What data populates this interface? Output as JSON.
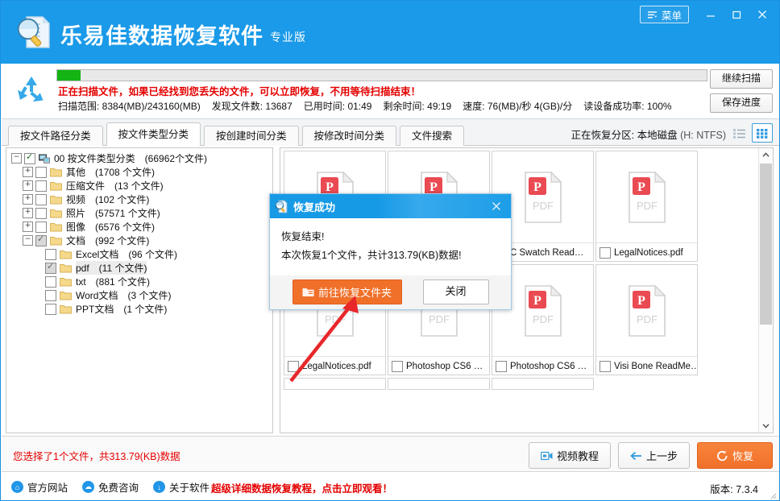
{
  "titlebar": {
    "brand": "乐易佳数据恢复软件",
    "edition": "专业版",
    "logo_icon": "magnifier-document-icon",
    "menu_label": "菜单",
    "menu_icon": "menu-lines-icon",
    "minimize_icon": "minimize-icon",
    "maximize_icon": "maximize-icon",
    "close_icon": "close-icon",
    "bg_color": "#1a9ae8"
  },
  "scan": {
    "recycle_icon": "recycle-arrows-icon",
    "progress_percent": 3.6,
    "progress_color": "#14b414",
    "warning": "正在扫描文件，如果已经找到您丢失的文件，可以立即恢复，不用等待扫描结束！",
    "warning_color": "#e40000",
    "stats": [
      "扫描范围: 8384(MB)/243160(MB)",
      "发现文件数: 13687",
      "已用时间: 01:49",
      "剩余时间: 49:19",
      "速度: 76(MB)/秒 4(GB)/分",
      "读设备成功率: 100%"
    ],
    "continue_label": "继续扫描",
    "save_label": "保存进度"
  },
  "tabs": {
    "items": [
      {
        "label": "按文件路径分类",
        "active": false
      },
      {
        "label": "按文件类型分类",
        "active": true
      },
      {
        "label": "按创建时间分类",
        "active": false
      },
      {
        "label": "按修改时间分类",
        "active": false
      },
      {
        "label": "文件搜索",
        "active": false
      }
    ],
    "partition_prefix": "正在恢复分区: 本地磁盘",
    "partition_detail": "(H: NTFS)",
    "list_view_icon": "list-view-icon",
    "grid_view_icon": "grid-view-icon",
    "active_view": "grid"
  },
  "tree": {
    "nodes": [
      {
        "indent": 0,
        "expander": "minus",
        "checked": true,
        "gray": false,
        "icon": "computer-icon",
        "label": "00 按文件类型分类　(66962个文件)",
        "selected": false
      },
      {
        "indent": 1,
        "expander": "plus",
        "checked": false,
        "gray": false,
        "icon": "folder-icon",
        "label": "其他　(1708 个文件)",
        "selected": false
      },
      {
        "indent": 1,
        "expander": "plus",
        "checked": false,
        "gray": false,
        "icon": "folder-icon",
        "label": "压缩文件　(13 个文件)",
        "selected": false
      },
      {
        "indent": 1,
        "expander": "plus",
        "checked": false,
        "gray": false,
        "icon": "folder-icon",
        "label": "视频　(102 个文件)",
        "selected": false
      },
      {
        "indent": 1,
        "expander": "plus",
        "checked": false,
        "gray": false,
        "icon": "folder-icon",
        "label": "照片　(57571 个文件)",
        "selected": false
      },
      {
        "indent": 1,
        "expander": "plus",
        "checked": false,
        "gray": false,
        "icon": "folder-icon",
        "label": "图像　(6576 个文件)",
        "selected": false
      },
      {
        "indent": 1,
        "expander": "minus",
        "checked": true,
        "gray": true,
        "icon": "folder-icon",
        "label": "文档　(992 个文件)",
        "selected": false
      },
      {
        "indent": 2,
        "expander": "none",
        "checked": false,
        "gray": false,
        "icon": "folder-icon",
        "label": "Excel文档　(96 个文件)",
        "selected": false
      },
      {
        "indent": 2,
        "expander": "none",
        "checked": true,
        "gray": true,
        "icon": "folder-icon",
        "label": "pdf　(11 个文件)",
        "selected": true
      },
      {
        "indent": 2,
        "expander": "none",
        "checked": false,
        "gray": false,
        "icon": "folder-icon",
        "label": "txt　(881 个文件)",
        "selected": false
      },
      {
        "indent": 2,
        "expander": "none",
        "checked": false,
        "gray": false,
        "icon": "folder-icon",
        "label": "Word文档　(3 个文件)",
        "selected": false
      },
      {
        "indent": 2,
        "expander": "none",
        "checked": false,
        "gray": false,
        "icon": "folder-icon",
        "label": "PPT文档　(1 个文件)",
        "selected": false
      }
    ]
  },
  "filegrid": {
    "tiles": [
      {
        "name": "",
        "icon": "pdf-file-icon",
        "checked": false,
        "row": 0,
        "col": 0,
        "partial": false
      },
      {
        "name": "",
        "icon": "pdf-file-icon",
        "checked": false,
        "row": 0,
        "col": 1,
        "partial": false
      },
      {
        "name": "C Swatch Read…",
        "icon": "pdf-file-icon",
        "checked": false,
        "row": 0,
        "col": 2,
        "partial": false
      },
      {
        "name": "LegalNotices.pdf",
        "icon": "pdf-file-icon",
        "checked": false,
        "row": 0,
        "col": 3,
        "partial": false
      },
      {
        "name": "LegalNotices.pdf",
        "icon": "pdf-file-icon",
        "checked": false,
        "row": 1,
        "col": 0,
        "partial": false
      },
      {
        "name": "Photoshop CS6 …",
        "icon": "pdf-file-icon",
        "checked": false,
        "row": 1,
        "col": 1,
        "partial": false
      },
      {
        "name": "Photoshop CS6 …",
        "icon": "pdf-file-icon",
        "checked": false,
        "row": 1,
        "col": 2,
        "partial": false
      },
      {
        "name": "Visi Bone ReadMe…",
        "icon": "pdf-file-icon",
        "checked": false,
        "row": 1,
        "col": 3,
        "partial": false
      },
      {
        "name": "",
        "icon": "pdf-file-icon",
        "checked": false,
        "row": 2,
        "col": 0,
        "partial": true
      },
      {
        "name": "",
        "icon": "pdf-file-icon",
        "checked": false,
        "row": 2,
        "col": 1,
        "partial": true
      },
      {
        "name": "",
        "icon": "pdf-file-icon",
        "checked": false,
        "row": 2,
        "col": 2,
        "partial": true
      }
    ],
    "pdf_label": "PDF",
    "scroll_up_icon": "chevron-up-icon",
    "scroll_down_icon": "chevron-down-icon"
  },
  "dialog": {
    "icon": "magnifier-document-icon",
    "title": "恢复成功",
    "close_icon": "close-icon",
    "line1": "恢复结束!",
    "line2": "本次恢复1个文件，共计313.79(KB)数据!",
    "ok_label": "前往恢复文件夹",
    "ok_icon": "folder-open-icon",
    "ok_color": "#f0702a",
    "cancel_label": "关闭",
    "annotation_icon": "red-arrow-annotation"
  },
  "bottom": {
    "selection_info": "您选择了1个文件，共313.79(KB)数据",
    "selection_color": "#e40000",
    "video_label": "视频教程",
    "video_icon": "video-camera-icon",
    "prev_label": "上一步",
    "prev_icon": "arrow-left-icon",
    "recover_label": "恢复",
    "recover_icon": "refresh-circle-icon"
  },
  "footer": {
    "links": [
      {
        "label": "官方网站",
        "icon": "home-icon"
      },
      {
        "label": "免费咨询",
        "icon": "chat-bubble-icon"
      },
      {
        "label": "关于软件",
        "icon": "info-download-icon"
      }
    ],
    "promo": "超级详细数据恢复教程，点击立即观看！",
    "promo_color": "#e40000",
    "version": "版本: 7.3.4",
    "grip_icon": "resize-grip-icon"
  }
}
